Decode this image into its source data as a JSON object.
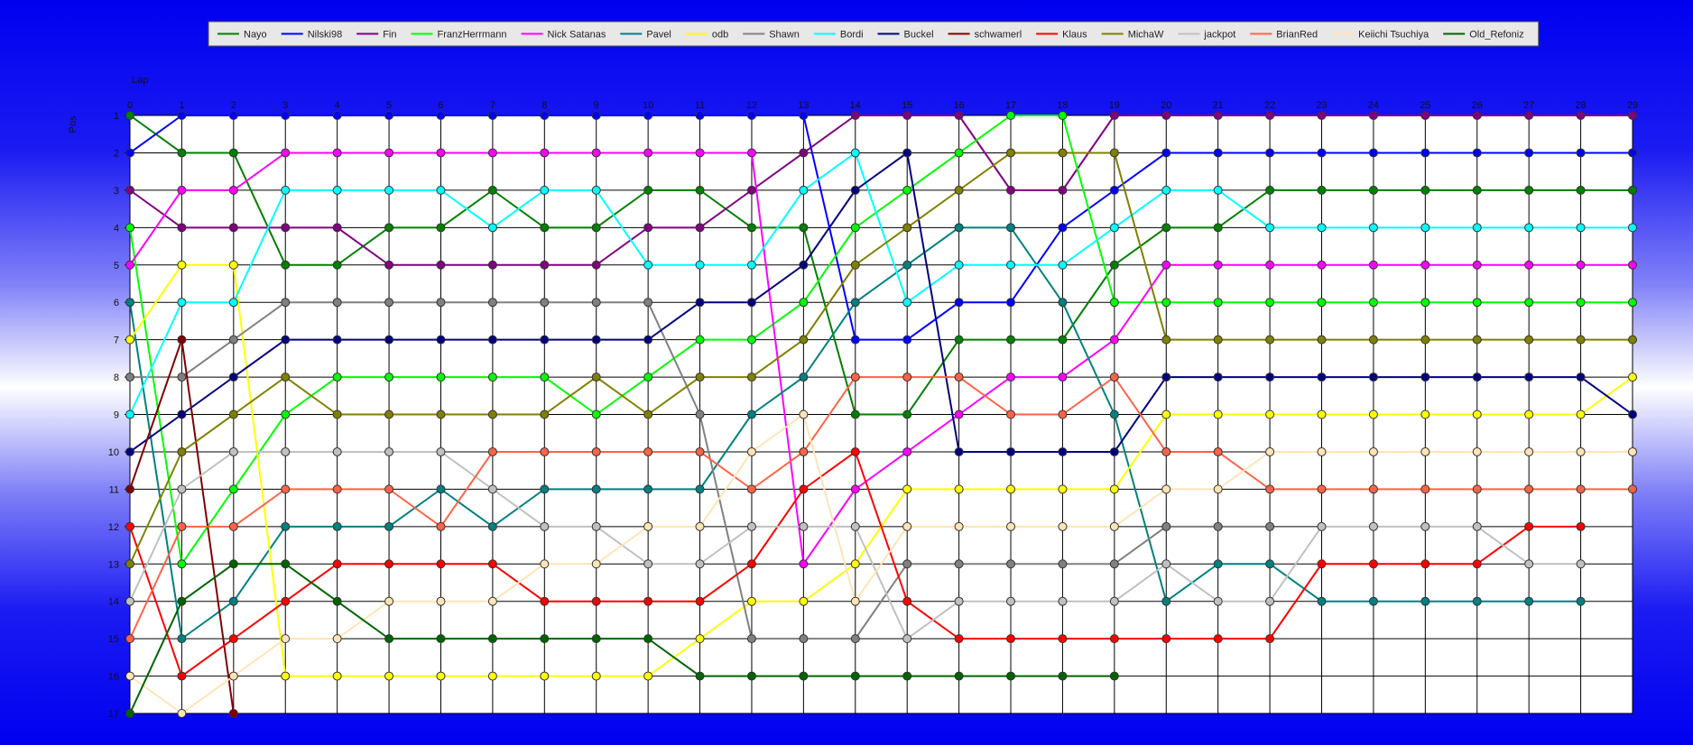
{
  "chart_data": {
    "type": "line",
    "xlabel": "Lap",
    "ylabel": "Pos",
    "x": [
      0,
      1,
      2,
      3,
      4,
      5,
      6,
      7,
      8,
      9,
      10,
      11,
      12,
      13,
      14,
      15,
      16,
      17,
      18,
      19,
      20,
      21,
      22,
      23,
      24,
      25,
      26,
      27,
      28,
      29
    ],
    "xlim": [
      0,
      29
    ],
    "ylim": [
      1,
      17
    ],
    "y_inverted": true,
    "grid": true,
    "legend_position": "top",
    "series": [
      {
        "name": "Nayo",
        "color": "#008000",
        "values": [
          1,
          2,
          2,
          5,
          5,
          4,
          4,
          3,
          4,
          4,
          3,
          3,
          4,
          4,
          9,
          9,
          7,
          7,
          7,
          5,
          4,
          4,
          3,
          3,
          3,
          3,
          3,
          3,
          3,
          3
        ]
      },
      {
        "name": "Nilski98",
        "color": "#0000ff",
        "values": [
          2,
          1,
          1,
          1,
          1,
          1,
          1,
          1,
          1,
          1,
          1,
          1,
          1,
          1,
          7,
          7,
          6,
          6,
          4,
          3,
          2,
          2,
          2,
          2,
          2,
          2,
          2,
          2,
          2,
          2
        ]
      },
      {
        "name": "Fin",
        "color": "#800080",
        "values": [
          3,
          4,
          4,
          4,
          4,
          5,
          5,
          5,
          5,
          5,
          4,
          4,
          3,
          2,
          1,
          1,
          1,
          3,
          3,
          1,
          1,
          1,
          1,
          1,
          1,
          1,
          1,
          1,
          1,
          1
        ]
      },
      {
        "name": "FranzHerrmann",
        "color": "#00ff00",
        "values": [
          4,
          13,
          11,
          9,
          8,
          8,
          8,
          8,
          8,
          9,
          8,
          7,
          7,
          6,
          4,
          3,
          2,
          1,
          1,
          6,
          6,
          6,
          6,
          6,
          6,
          6,
          6,
          6,
          6,
          6
        ]
      },
      {
        "name": "Nick Satanas",
        "color": "#ff00ff",
        "values": [
          5,
          3,
          3,
          2,
          2,
          2,
          2,
          2,
          2,
          2,
          2,
          2,
          2,
          13,
          11,
          10,
          9,
          8,
          8,
          7,
          5,
          5,
          5,
          5,
          5,
          5,
          5,
          5,
          5,
          5
        ]
      },
      {
        "name": "Pavel",
        "color": "#008080",
        "values": [
          6,
          15,
          14,
          12,
          12,
          12,
          11,
          12,
          11,
          11,
          11,
          11,
          9,
          8,
          6,
          5,
          4,
          4,
          6,
          9,
          14,
          13,
          13,
          14,
          14,
          14,
          14,
          14,
          14,
          null
        ]
      },
      {
        "name": "odb",
        "color": "#ffff00",
        "values": [
          7,
          5,
          5,
          16,
          16,
          16,
          16,
          16,
          16,
          16,
          16,
          15,
          14,
          14,
          13,
          11,
          11,
          11,
          11,
          11,
          9,
          9,
          9,
          9,
          9,
          9,
          9,
          9,
          9,
          8
        ]
      },
      {
        "name": "Shawn",
        "color": "#808080",
        "values": [
          8,
          8,
          7,
          6,
          6,
          6,
          6,
          6,
          6,
          6,
          6,
          9,
          15,
          15,
          15,
          13,
          13,
          13,
          13,
          13,
          12,
          12,
          12,
          null,
          null,
          null,
          null,
          null,
          null,
          null
        ]
      },
      {
        "name": "Bordi",
        "color": "#00ffff",
        "values": [
          9,
          6,
          6,
          3,
          3,
          3,
          3,
          4,
          3,
          3,
          5,
          5,
          5,
          3,
          2,
          6,
          5,
          5,
          5,
          4,
          3,
          3,
          4,
          4,
          4,
          4,
          4,
          4,
          4,
          4
        ]
      },
      {
        "name": "Buckel",
        "color": "#000080",
        "values": [
          10,
          9,
          8,
          7,
          7,
          7,
          7,
          7,
          7,
          7,
          7,
          6,
          6,
          5,
          3,
          2,
          10,
          10,
          10,
          10,
          8,
          8,
          8,
          8,
          8,
          8,
          8,
          8,
          8,
          9
        ]
      },
      {
        "name": "schwamerl",
        "color": "#800000",
        "values": [
          11,
          7,
          17,
          null,
          null,
          null,
          null,
          null,
          null,
          null,
          null,
          null,
          null,
          null,
          null,
          null,
          null,
          null,
          null,
          null,
          null,
          null,
          null,
          null,
          null,
          null,
          null,
          null,
          null,
          null
        ]
      },
      {
        "name": "Klaus",
        "color": "#ff0000",
        "values": [
          12,
          16,
          15,
          14,
          13,
          13,
          13,
          13,
          14,
          14,
          14,
          14,
          13,
          11,
          10,
          14,
          15,
          15,
          15,
          15,
          15,
          15,
          15,
          13,
          13,
          13,
          13,
          12,
          12,
          null
        ]
      },
      {
        "name": "MichaW",
        "color": "#808000",
        "values": [
          13,
          10,
          9,
          8,
          9,
          9,
          9,
          9,
          9,
          8,
          9,
          8,
          8,
          7,
          5,
          4,
          3,
          2,
          2,
          2,
          7,
          7,
          7,
          7,
          7,
          7,
          7,
          7,
          7,
          7
        ]
      },
      {
        "name": "jackpot",
        "color": "#c0c0c0",
        "values": [
          14,
          11,
          10,
          10,
          10,
          10,
          10,
          11,
          12,
          12,
          13,
          13,
          12,
          12,
          12,
          15,
          14,
          14,
          14,
          14,
          13,
          14,
          14,
          12,
          12,
          12,
          12,
          13,
          13,
          null
        ]
      },
      {
        "name": "BrianRed",
        "color": "#ff6347",
        "values": [
          15,
          12,
          12,
          11,
          11,
          11,
          12,
          10,
          10,
          10,
          10,
          10,
          11,
          10,
          8,
          8,
          8,
          9,
          9,
          8,
          10,
          10,
          11,
          11,
          11,
          11,
          11,
          11,
          11,
          11
        ]
      },
      {
        "name": "Keiichi Tsuchiya",
        "color": "#ffe4b5",
        "values": [
          16,
          17,
          16,
          15,
          15,
          14,
          14,
          14,
          13,
          13,
          12,
          12,
          10,
          9,
          14,
          12,
          12,
          12,
          12,
          12,
          11,
          11,
          10,
          10,
          10,
          10,
          10,
          10,
          10,
          10
        ]
      },
      {
        "name": "Old_Refoniz",
        "color": "#006400",
        "values": [
          17,
          14,
          13,
          13,
          14,
          15,
          15,
          15,
          15,
          15,
          15,
          16,
          16,
          16,
          16,
          16,
          16,
          16,
          16,
          16,
          null,
          null,
          null,
          null,
          null,
          null,
          null,
          null,
          null,
          null
        ]
      }
    ]
  }
}
